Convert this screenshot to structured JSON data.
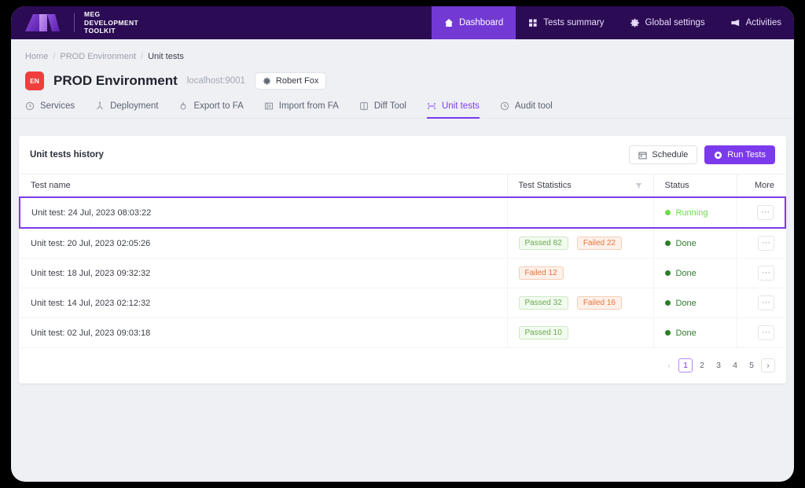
{
  "brand": {
    "line1": "MEG",
    "line2": "DEVELOPMENT",
    "line3": "TOOLKIT"
  },
  "nav": {
    "items": [
      {
        "label": "Dashboard",
        "icon": "home-icon",
        "active": true
      },
      {
        "label": "Tests summary",
        "icon": "grid-icon",
        "active": false
      },
      {
        "label": "Global settings",
        "icon": "gear-icon",
        "active": false
      },
      {
        "label": "Activities",
        "icon": "megaphone-icon",
        "active": false
      }
    ]
  },
  "breadcrumb": {
    "home": "Home",
    "env": "PROD Environment",
    "current": "Unit tests",
    "separator": "/"
  },
  "header": {
    "lang_badge": "EN",
    "title": "PROD Environment",
    "host": "localhost:9001",
    "user": "Robert Fox"
  },
  "tabs": [
    {
      "label": "Services",
      "icon": "clock-icon",
      "active": false
    },
    {
      "label": "Deployment",
      "icon": "hierarchy-icon",
      "active": false
    },
    {
      "label": "Export to FA",
      "icon": "export-icon",
      "active": false
    },
    {
      "label": "Import from FA",
      "icon": "import-icon",
      "active": false
    },
    {
      "label": "Diff Tool",
      "icon": "diff-icon",
      "active": false
    },
    {
      "label": "Unit tests",
      "icon": "unit-tests-icon",
      "active": true
    },
    {
      "label": "Audit tool",
      "icon": "audit-icon",
      "active": false
    }
  ],
  "card": {
    "title": "Unit tests history",
    "schedule_label": "Schedule",
    "run_label": "Run Tests"
  },
  "table": {
    "columns": {
      "name": "Test name",
      "stats": "Test Statistics",
      "status": "Status",
      "more": "More"
    },
    "rows": [
      {
        "name": "Unit test: 24 Jul, 2023 08:03:22",
        "passed": null,
        "failed": null,
        "status": "Running",
        "status_kind": "running",
        "selected": true,
        "more": "···"
      },
      {
        "name": "Unit test: 20 Jul, 2023 02:05:26",
        "passed": "Passed  82",
        "failed": "Failed 22",
        "status": "Done",
        "status_kind": "done",
        "selected": false,
        "more": "···"
      },
      {
        "name": "Unit test: 18 Jul, 2023 09:32:32",
        "passed": null,
        "failed": "Failed 12",
        "status": "Done",
        "status_kind": "done",
        "selected": false,
        "more": "···"
      },
      {
        "name": "Unit test: 14 Jul, 2023 02:12:32",
        "passed": "Passed  32",
        "failed": "Failed 16",
        "status": "Done",
        "status_kind": "done",
        "selected": false,
        "more": "···"
      },
      {
        "name": "Unit test: 02 Jul, 2023 09:03:18",
        "passed": "Passed 10",
        "failed": null,
        "status": "Done",
        "status_kind": "done",
        "selected": false,
        "more": "···"
      }
    ]
  },
  "pagination": {
    "prev": "‹",
    "pages": [
      "1",
      "2",
      "3",
      "4",
      "5"
    ],
    "active_page": "1",
    "next": "›"
  },
  "colors": {
    "nav_bg": "#2b0b54",
    "nav_active": "#7339d4",
    "accent": "#7c3aed",
    "page_bg": "#eef0f4",
    "badge_red": "#f03e3e",
    "pass_green": "#6aa84f",
    "fail_orange": "#e8743b",
    "running_green": "#6ddb4a",
    "done_green": "#2a7d27"
  }
}
